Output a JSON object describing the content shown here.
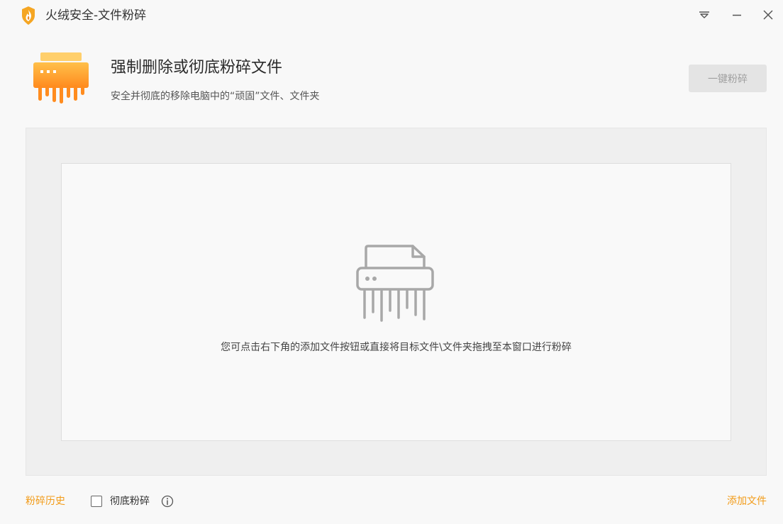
{
  "window": {
    "title": "火绒安全-文件粉碎"
  },
  "header": {
    "title": "强制删除或彻底粉碎文件",
    "subtitle": "安全并彻底的移除电脑中的“顽固”文件、文件夹",
    "shred_button_label": "一键粉碎"
  },
  "drop_area": {
    "hint": "您可点击右下角的添加文件按钮或直接将目标文件\\文件夹拖拽至本窗口进行粉碎"
  },
  "footer": {
    "history_label": "粉碎历史",
    "thorough_label": "彻底粉碎",
    "thorough_checked": false,
    "add_file_label": "添加文件"
  },
  "colors": {
    "accent": "#f29b18",
    "background": "#f8f8f8",
    "disabled_button": "#e4e4e4"
  }
}
